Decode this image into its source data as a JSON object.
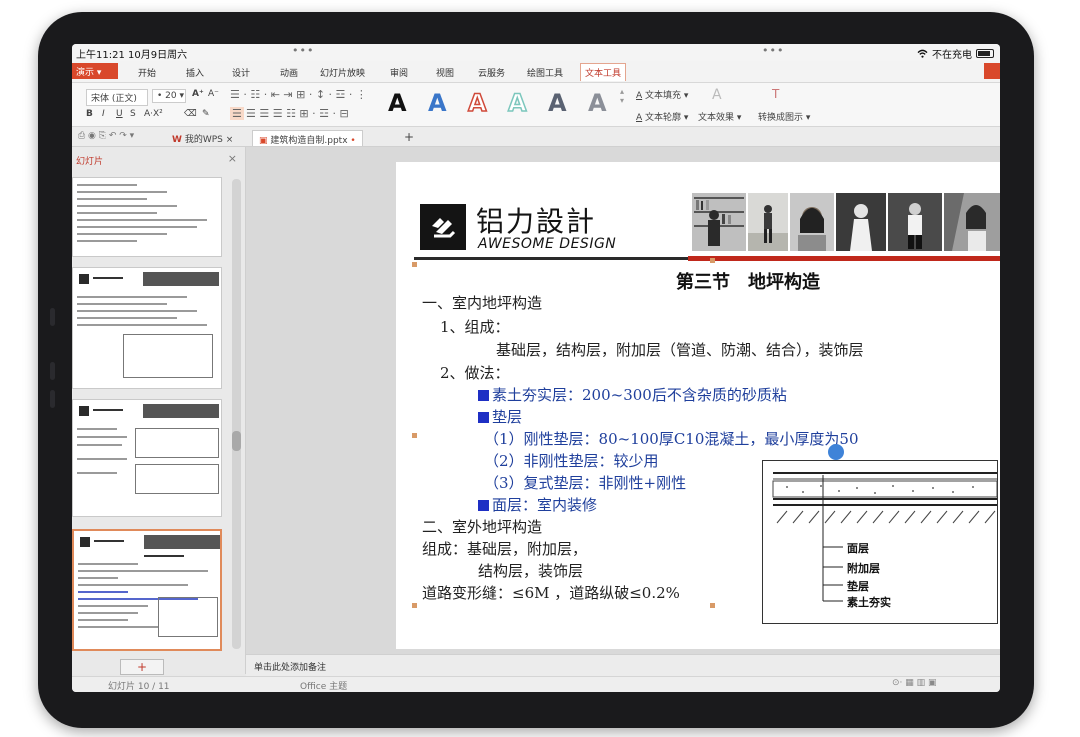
{
  "status_bar": {
    "time": "上午11:21",
    "date": "10月9日周六",
    "dots": "•••",
    "charging": "不在充电"
  },
  "ribbon": {
    "app_menu": "演示",
    "tabs": [
      "开始",
      "插入",
      "设计",
      "动画",
      "幻灯片放映",
      "审阅",
      "视图",
      "云服务",
      "绘图工具",
      "文本工具"
    ],
    "active_tab": "文本工具"
  },
  "toolbar": {
    "font_name": "宋体 (正文)",
    "font_size": "20",
    "bold": "B",
    "italic": "I",
    "underline": "U",
    "strike": "S",
    "text_fill": "文本填充",
    "text_outline": "文本轮廓",
    "text_effect": "文本效果",
    "convert_art": "转换成图示",
    "big_a": "A"
  },
  "doc_tabs": {
    "my_wps": "我的WPS",
    "file_name": "建筑构造自制.pptx",
    "add_tab": "+"
  },
  "thumbnails": {
    "header": "幻灯片",
    "close": "×",
    "add_button": "+"
  },
  "slide": {
    "logo_cn": "铝力設計",
    "logo_en": "AWESOME DESIGN",
    "title": "第三节　地坪构造",
    "lines": [
      "一、室内地坪构造",
      "1、组成：",
      "基础层，结构层，附加层（管道、防潮、结合），装饰层",
      "2、做法：",
      "素土夯实层：200~300后不含杂质的砂质粘",
      "垫层",
      "（1）刚性垫层：80~100厚C10混凝土，最小厚度为50",
      "（2）非刚性垫层：较少用",
      "（3）复式垫层：非刚性+刚性",
      "面层：室内装修",
      "二、室外地坪构造",
      "组成：基础层，附加层，",
      "结构层，装饰层",
      "道路变形缝：≤6M ，道路纵破≤0.2%"
    ],
    "diagram_labels": [
      "面层",
      "附加层",
      "垫层",
      "素土夯实"
    ]
  },
  "notes": {
    "placeholder": "单击此处添加备注"
  },
  "bottom_bar": {
    "slide_count": "幻灯片 10 / 11",
    "theme": "Office 主题"
  },
  "colors": {
    "accent": "#d9482b",
    "title_red": "#c0281b",
    "text_blue": "#1f3f9c",
    "bullet_blue": "#1e2fc4"
  }
}
